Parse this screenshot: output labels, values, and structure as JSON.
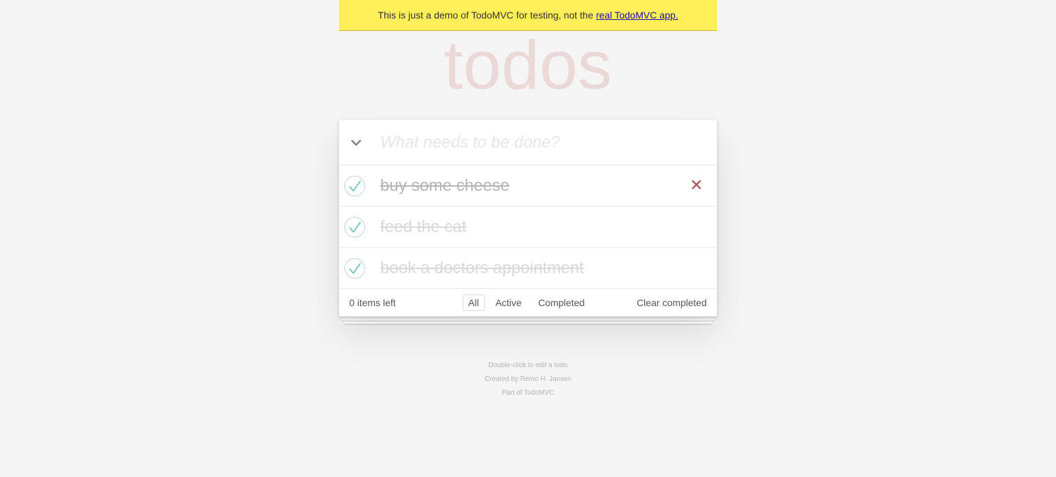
{
  "banner": {
    "text": "This is just a demo of TodoMVC for testing, not the",
    "link_text": "real TodoMVC app."
  },
  "app": {
    "title": "todos"
  },
  "new_todo": {
    "placeholder": "What needs to be done?",
    "value": ""
  },
  "todos": [
    {
      "label": "buy some cheese",
      "completed": true
    },
    {
      "label": "feed the cat",
      "completed": true
    },
    {
      "label": "book a doctors appointment",
      "completed": true
    }
  ],
  "footer": {
    "count": "0 items left",
    "filters": [
      "All",
      "Active",
      "Completed"
    ],
    "selected_filter": "All",
    "clear_completed": "Clear completed"
  },
  "info": {
    "line1": "Double-click to edit a todo",
    "line2": "Created by Remo H. Jansen",
    "line3": "Part of TodoMVC"
  },
  "colors": {
    "banner_bg": "#fff05a",
    "title": "#b83f45",
    "check": "#5dc2af",
    "destroy": "#af5b5e"
  },
  "icons": {
    "toggle_all": "chevron-down-icon",
    "check": "checkmark-icon",
    "destroy": "close-icon"
  }
}
